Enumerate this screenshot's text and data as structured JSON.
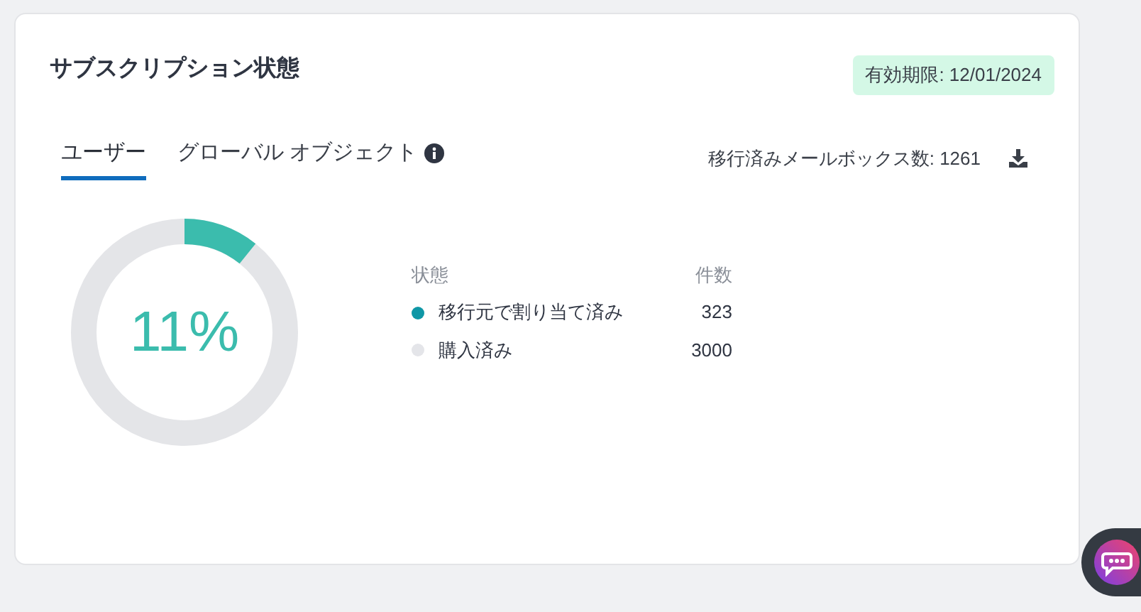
{
  "card": {
    "title": "サブスクリプション状態",
    "badge": "有効期限: 12/01/2024"
  },
  "tabs": [
    {
      "label": "ユーザー",
      "selected": true,
      "info": false
    },
    {
      "label": "グローバル オブジェクト",
      "selected": false,
      "info": true
    }
  ],
  "migrated": {
    "label": "移行済みメールボックス数: 1261"
  },
  "ring": {
    "level": 0.1077,
    "percent": "11%"
  },
  "legend": {
    "columns": [
      "状態",
      "件数"
    ],
    "rows": [
      {
        "label": "移行元で割り当て済み",
        "count": "323",
        "color": "#0f97a6"
      },
      {
        "label": "購入済み",
        "count": "3000",
        "color": "#e4e5e9"
      }
    ]
  }
}
